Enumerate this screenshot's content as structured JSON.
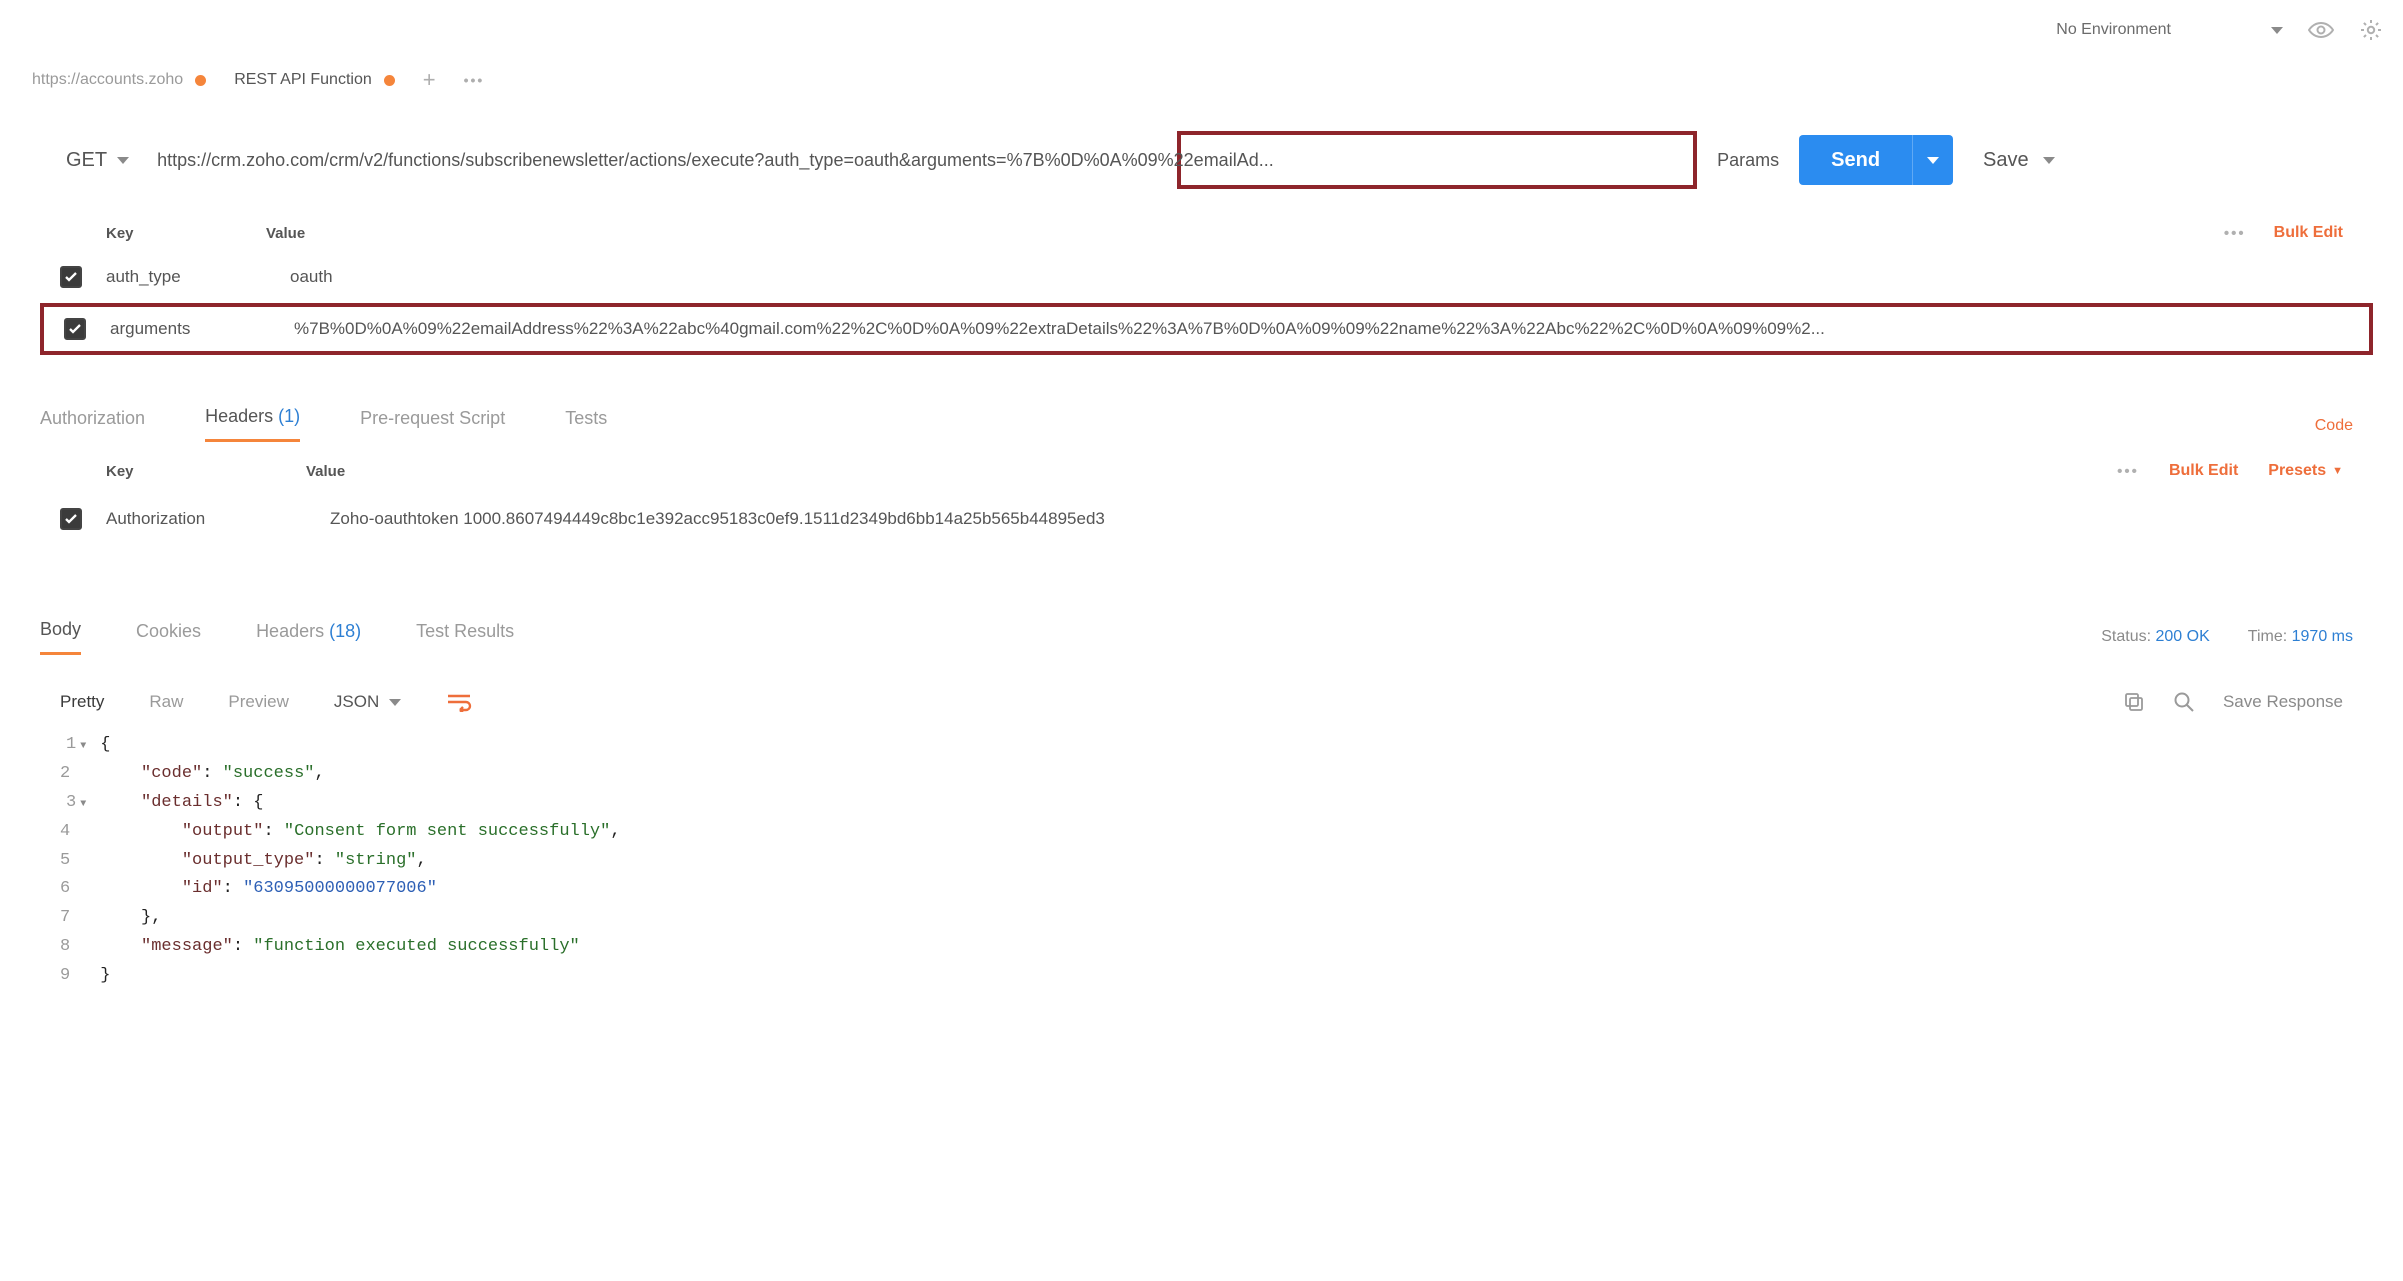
{
  "topbar": {
    "environment": "No Environment"
  },
  "tabs": [
    {
      "label": "https://accounts.zoho",
      "active": false,
      "modified": true
    },
    {
      "label": "REST API Function",
      "active": true,
      "modified": true
    }
  ],
  "request": {
    "method": "GET",
    "url": "https://crm.zoho.com/crm/v2/functions/subscribenewsletter/actions/execute?auth_type=oauth&arguments=%7B%0D%0A%09%22emailAd...",
    "params_label": "Params",
    "send_label": "Send",
    "save_label": "Save"
  },
  "params_header": {
    "key_label": "Key",
    "value_label": "Value",
    "bulk_edit": "Bulk Edit"
  },
  "params": [
    {
      "checked": true,
      "key": "auth_type",
      "value": "oauth",
      "highlight": false
    },
    {
      "checked": true,
      "key": "arguments",
      "value": "%7B%0D%0A%09%22emailAddress%22%3A%22abc%40gmail.com%22%2C%0D%0A%09%22extraDetails%22%3A%7B%0D%0A%09%09%22name%22%3A%22Abc%22%2C%0D%0A%09%09%2...",
      "highlight": true
    }
  ],
  "req_tabs": {
    "authorization": "Authorization",
    "headers": "Headers",
    "headers_count": "(1)",
    "prerequest": "Pre-request Script",
    "tests": "Tests",
    "code_link": "Code"
  },
  "headers_header": {
    "key_label": "Key",
    "value_label": "Value",
    "bulk_edit": "Bulk Edit",
    "presets": "Presets"
  },
  "headers": [
    {
      "checked": true,
      "key": "Authorization",
      "value": "Zoho-oauthtoken 1000.8607494449c8bc1e392acc95183c0ef9.1511d2349bd6bb14a25b565b44895ed3"
    }
  ],
  "resp_tabs": {
    "body": "Body",
    "cookies": "Cookies",
    "headers": "Headers",
    "headers_count": "(18)",
    "test_results": "Test Results"
  },
  "resp_meta": {
    "status_label": "Status:",
    "status_value": "200 OK",
    "time_label": "Time:",
    "time_value": "1970 ms"
  },
  "body_controls": {
    "pretty": "Pretty",
    "raw": "Raw",
    "preview": "Preview",
    "format": "JSON",
    "save_response": "Save Response"
  },
  "response_body": {
    "line1": "{",
    "line2_key": "\"code\"",
    "line2_val": "\"success\"",
    "line3_key": "\"details\"",
    "line4_key": "\"output\"",
    "line4_val": "\"Consent form sent successfully\"",
    "line5_key": "\"output_type\"",
    "line5_val": "\"string\"",
    "line6_key": "\"id\"",
    "line6_val": "\"63095000000077006\"",
    "line8_key": "\"message\"",
    "line8_val": "\"function executed successfully\"",
    "ln": {
      "l1": "1",
      "l2": "2",
      "l3": "3",
      "l4": "4",
      "l5": "5",
      "l6": "6",
      "l7": "7",
      "l8": "8",
      "l9": "9"
    }
  }
}
